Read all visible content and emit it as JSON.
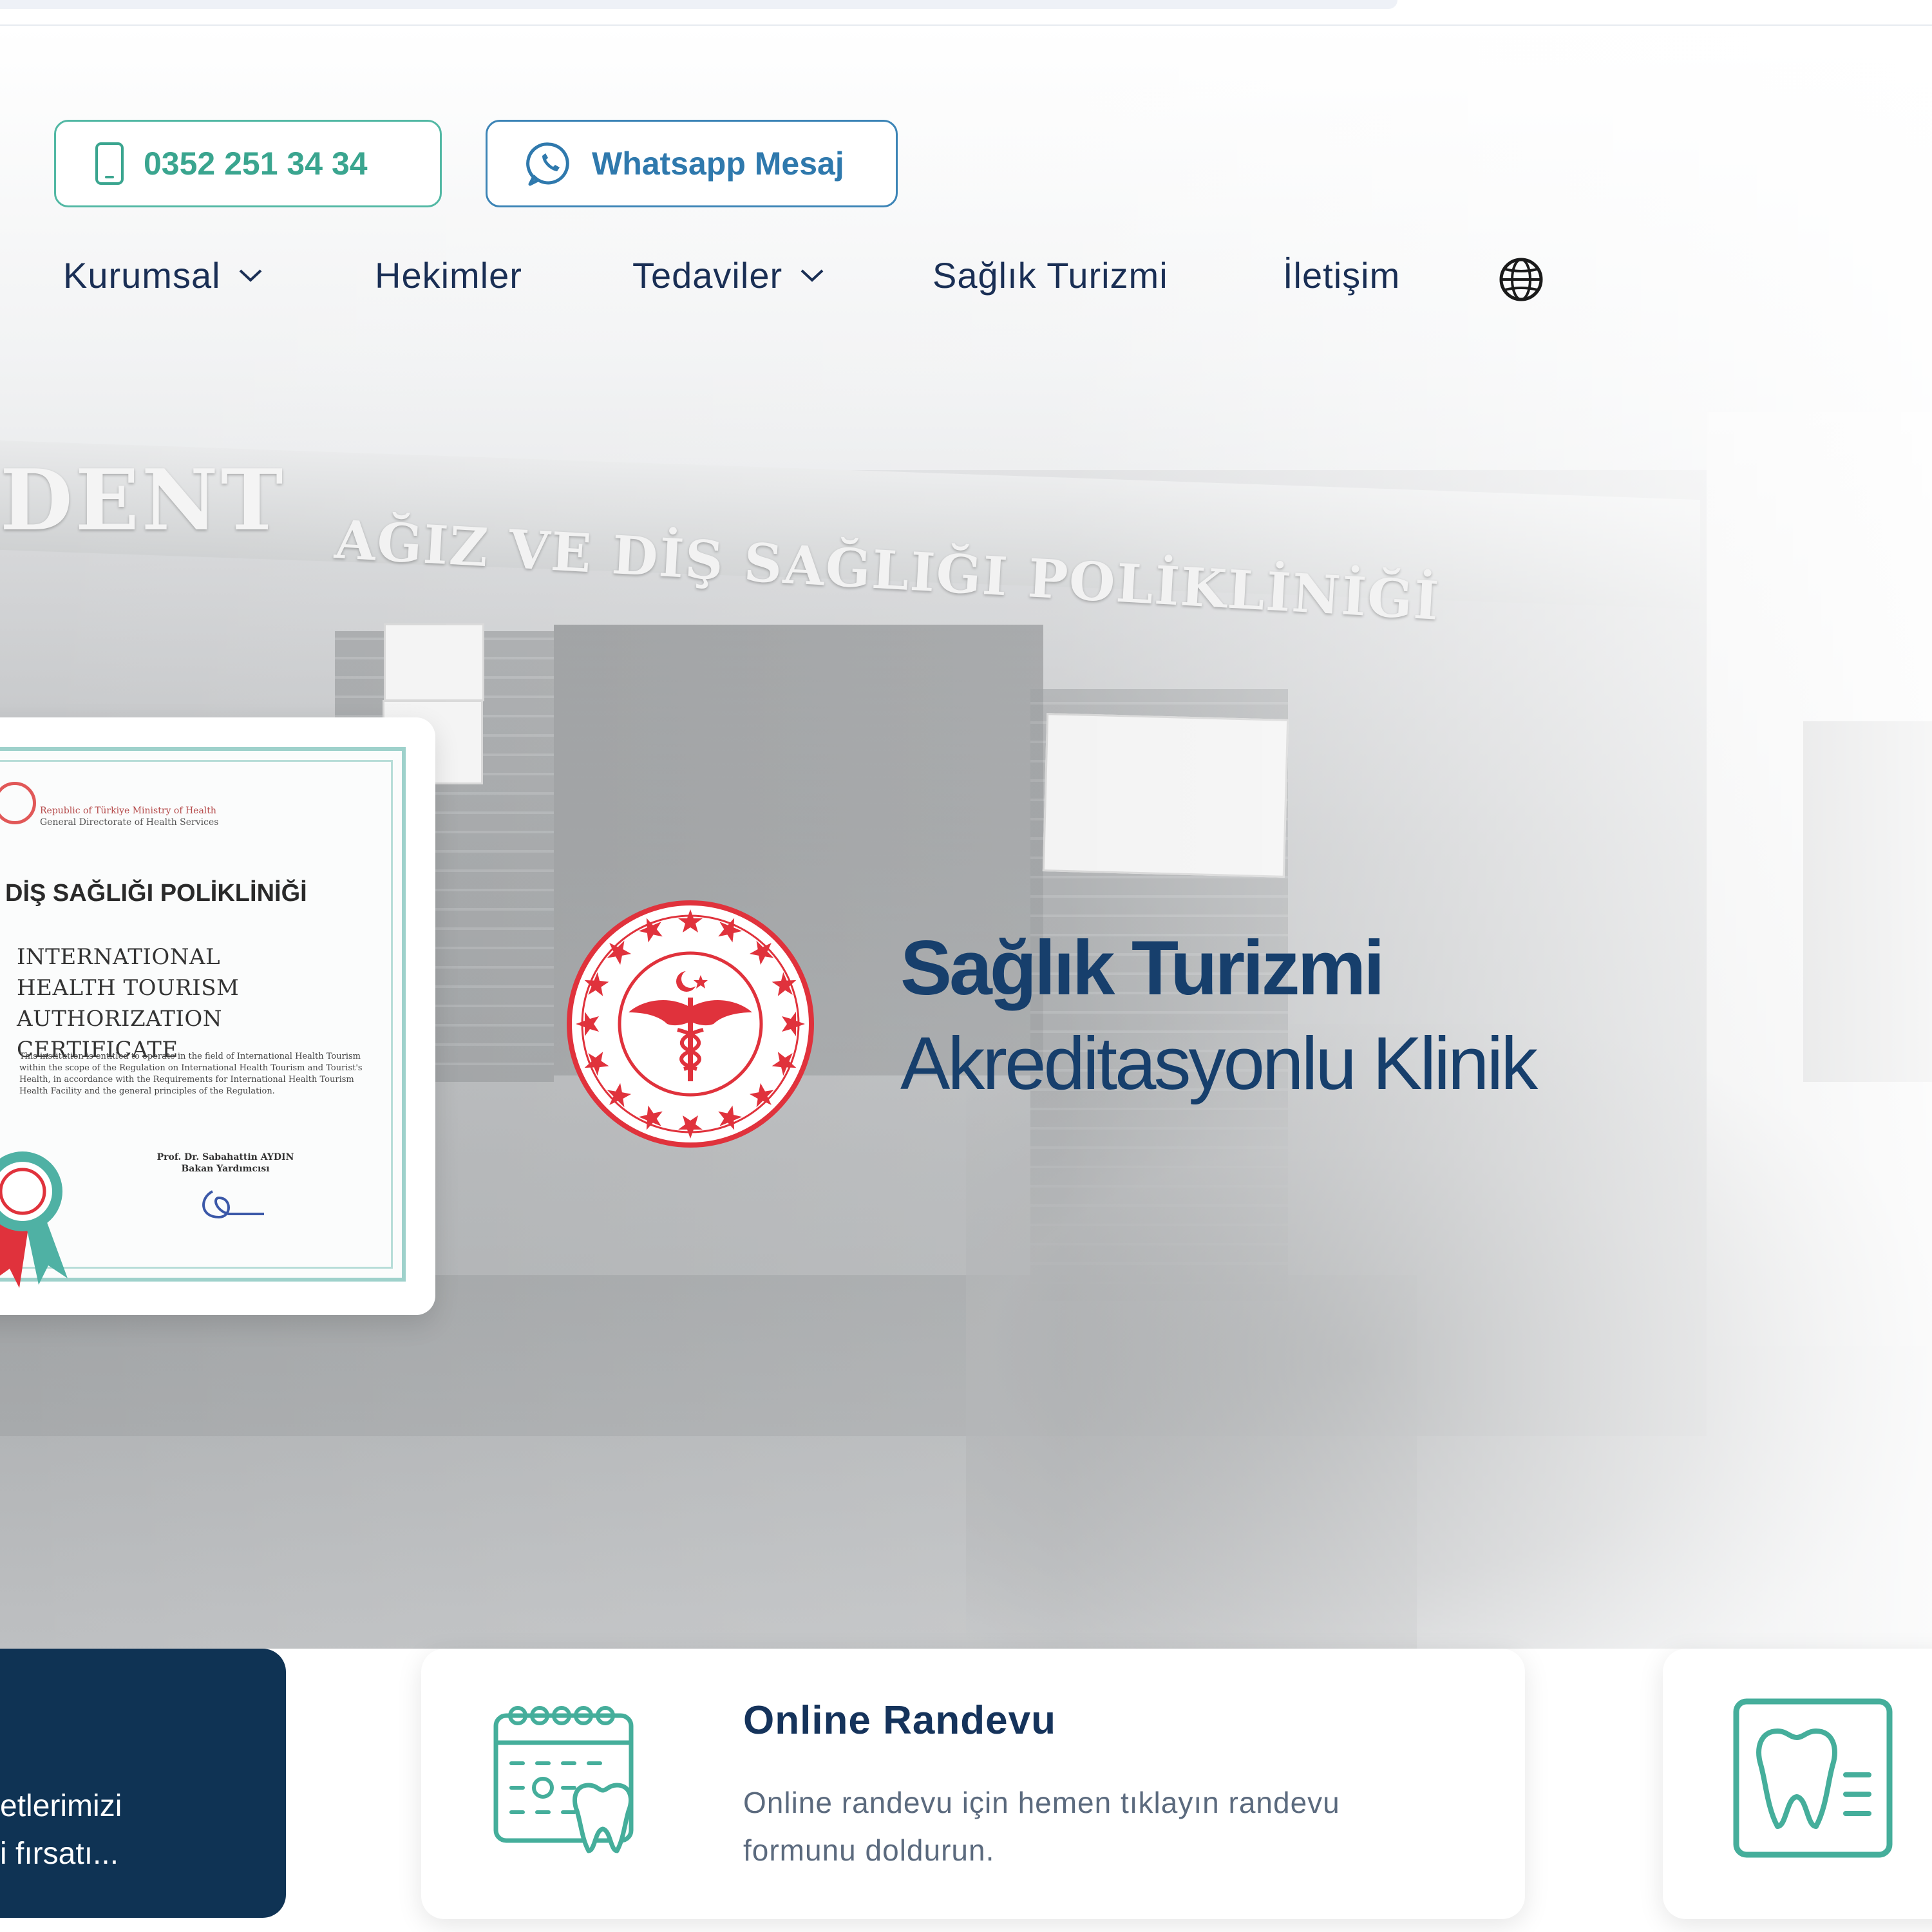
{
  "header": {
    "phone_label": "0352 251 34 34",
    "whatsapp_label": "Whatsapp Mesaj"
  },
  "nav": {
    "items": [
      {
        "label": "Kurumsal",
        "dropdown": true
      },
      {
        "label": "Hekimler",
        "dropdown": false
      },
      {
        "label": "Tedaviler",
        "dropdown": true
      },
      {
        "label": "Sağlık Turizmi",
        "dropdown": false
      },
      {
        "label": "İletişim",
        "dropdown": false
      }
    ]
  },
  "hero": {
    "sign_brand_fragment": "DENT",
    "sign_clinic": "AĞIZ VE DİŞ SAĞLIĞI POLİKLİNİĞİ",
    "accreditation_title": "Sağlık Turizmi",
    "accreditation_subtitle": "Akreditasyonlu Klinik"
  },
  "certificate": {
    "ministry_line1": "Republic of Türkiye Ministry of Health",
    "ministry_line2": "General Directorate of Health Services",
    "clinic_name": "DİŞ SAĞLIĞI POLİKLİNİĞİ",
    "title_line1": "INTERNATIONAL",
    "title_line2": "HEALTH TOURISM",
    "title_line3": "AUTHORIZATION CERTIFICATE",
    "body": "This institution is entitled to operate in the field of International Health Tourism within the scope of the Regulation on International Health Tourism and Tourist's Health, in accordance with the Requirements for International Health Tourism Health Facility and the general principles of the Regulation.",
    "signer_name": "Prof. Dr. Sabahattin AYDIN",
    "signer_title": "Bakan Yardımcısı"
  },
  "cards": {
    "dark_line1": "etlerimizi",
    "dark_line2": "i fırsatı...",
    "randevu_title": "Online Randevu",
    "randevu_desc_line1": "Online randevu için hemen tıklayın randevu",
    "randevu_desc_line2": "formunu doldurun."
  },
  "colors": {
    "navy": "#173f6c",
    "teal": "#3aa58f",
    "whatsapp_blue": "#2f79ad",
    "seal_red": "#e0323c",
    "dark_card": "#0f3354"
  },
  "icons": {
    "phone": "mobile-phone-icon",
    "whatsapp": "whatsapp-icon",
    "globe": "globe-icon",
    "calendar": "calendar-tooth-icon",
    "tooth_doc": "tooth-document-icon",
    "dropdown": "chevron-down-icon"
  }
}
